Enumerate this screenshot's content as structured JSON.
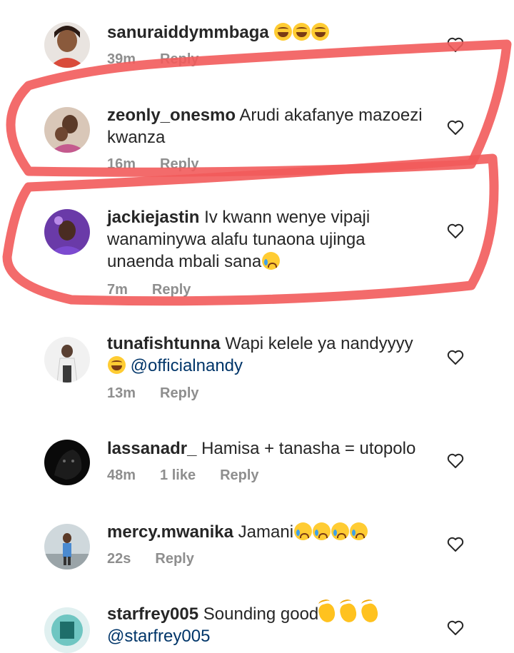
{
  "comments": [
    {
      "username": "sanuraiddymmbaga",
      "text": "",
      "emojis": [
        "laugh",
        "laugh",
        "laugh"
      ],
      "mention": "",
      "time": "39m",
      "likes": "",
      "reply": "Reply"
    },
    {
      "username": "zeonly_onesmo",
      "text": "Arudi akafanye mazoezi kwanza",
      "emojis": [],
      "mention": "",
      "time": "16m",
      "likes": "",
      "reply": "Reply"
    },
    {
      "username": "jackiejastin",
      "text": "Iv kwann wenye vipaji wanaminywa alafu tunaona ujinga unaenda mbali sana",
      "emojis": [
        "cry"
      ],
      "mention": "",
      "time": "7m",
      "likes": "",
      "reply": "Reply"
    },
    {
      "username": "tunafishtunna",
      "text": "Wapi kelele ya nandyyyy",
      "emojis": [
        "laugh"
      ],
      "mention": "@officialnandy",
      "time": "13m",
      "likes": "",
      "reply": "Reply"
    },
    {
      "username": "lassanadr_",
      "text": "Hamisa + tanasha = utopolo",
      "emojis": [],
      "mention": "",
      "time": "48m",
      "likes": "1 like",
      "reply": "Reply"
    },
    {
      "username": "mercy.mwanika",
      "text": "Jamani",
      "emojis": [
        "cry",
        "cry",
        "cry",
        "cry"
      ],
      "mention": "",
      "time": "22s",
      "likes": "",
      "reply": "Reply"
    },
    {
      "username": "starfrey005",
      "text": "Sounding good",
      "emojis": [
        "clap",
        "clap",
        "clap"
      ],
      "mention": "@starfrey005",
      "time": "",
      "likes": "",
      "reply": ""
    }
  ],
  "colors": {
    "username": "#262626",
    "meta": "#8e8e8e",
    "mention": "#003569",
    "annotation": "#f25b5b"
  },
  "icons": {
    "like": "heart-outline-icon"
  }
}
